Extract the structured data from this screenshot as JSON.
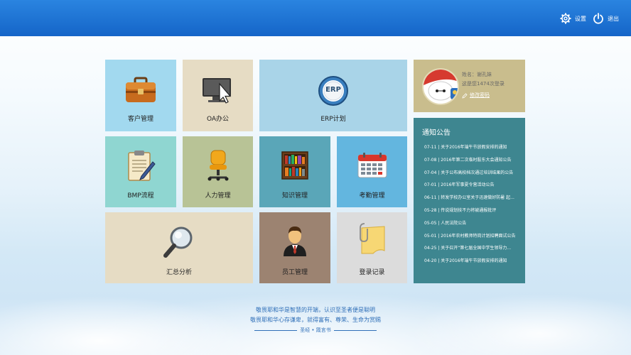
{
  "header": {
    "settings_label": "设置",
    "logout_label": "退出"
  },
  "tiles": {
    "customer": "客户管理",
    "oa": "OA办公",
    "erp": "ERP计划",
    "erp_logo_text": "ERP",
    "bmp": "BMP流程",
    "hr": "人力管理",
    "knowledge": "知识管理",
    "attendance": "考勤管理",
    "summary": "汇总分析",
    "staff": "员工管理",
    "login_record": "登录记录"
  },
  "user": {
    "name_line": "姓名：谢孔妹",
    "login_count_line": "这是您1474次登录",
    "change_password": "修改密码"
  },
  "notices": {
    "title": "通知公告",
    "items": [
      "07-11 | 关于2016年端午节放假安排的通知",
      "07-08 | 2016年第二次临时股东大会通知公告",
      "07-04 | 关于公布高校档次通过培训结果的公告",
      "07-01 | 2016年军事夏令营活动公告",
      "06-11 | 转发学校办公室关于迅速做好防暑 起...",
      "05-28 | 传说规划技不力将被通报批评",
      "05-05 | 人民法院公告",
      "05-01 | 2016年农村教师特岗计划招聘面试公告",
      "04-25 | 关于召开“第七届全国中学生领导力...",
      "04-20 | 关于2016年端午节放假安排的通知"
    ]
  },
  "quote": {
    "line1": "敬畏耶和华是智慧的开端，认识至圣者便是聪明",
    "line2": "敬畏耶和华心存谦卑，就得富有、尊荣、生命为赏赐",
    "source": "圣经 • 箴言书"
  },
  "colors": {
    "header_blue": "#1a6fd0",
    "notice_bg": "#3e8690",
    "user_card_bg": "#c9bd8d"
  }
}
